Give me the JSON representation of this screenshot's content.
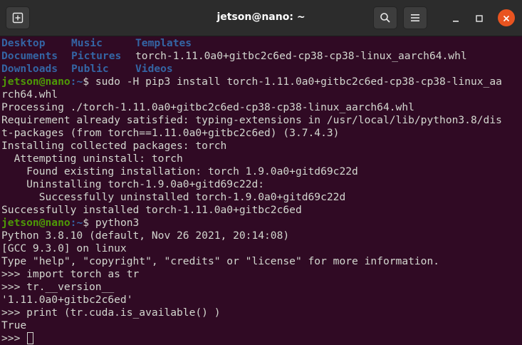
{
  "window": {
    "title": "jetson@nano: ~",
    "icons": {
      "new_tab": "new-tab-icon",
      "search": "search-icon",
      "menu": "hamburger-menu-icon",
      "minimize": "minimize-icon",
      "maximize": "maximize-icon",
      "close": "close-icon"
    },
    "colors": {
      "background": "#300a24",
      "titlebar": "#2c2c2c",
      "close": "#e95420",
      "dir": "#3465a4",
      "user": "#4e9a06",
      "text": "#d3d7cf"
    }
  },
  "ls_listing": [
    [
      "Desktop",
      "Music",
      "Templates"
    ],
    [
      "Documents",
      "Pictures",
      "torch-1.11.0a0+gitbc2c6ed-cp38-cp38-linux_aarch64.whl"
    ],
    [
      "Downloads",
      "Public",
      "Videos"
    ]
  ],
  "prompt": {
    "user": "jetson@nano",
    "path": ":~",
    "symbol": "$ "
  },
  "commands": {
    "pip_a": "sudo -H pip3 install torch-1.11.0a0+gitbc2c6ed-cp38-cp38-linux_aa",
    "pip_b": "rch64.whl",
    "python": "python3"
  },
  "output": {
    "l1": "Processing ./torch-1.11.0a0+gitbc2c6ed-cp38-cp38-linux_aarch64.whl",
    "l2": "Requirement already satisfied: typing-extensions in /usr/local/lib/python3.8/dis",
    "l3": "t-packages (from torch==1.11.0a0+gitbc2c6ed) (3.7.4.3)",
    "l4": "Installing collected packages: torch",
    "l5": "  Attempting uninstall: torch",
    "l6": "    Found existing installation: torch 1.9.0a0+gitd69c22d",
    "l7": "    Uninstalling torch-1.9.0a0+gitd69c22d:",
    "l8": "      Successfully uninstalled torch-1.9.0a0+gitd69c22d",
    "l9": "Successfully installed torch-1.11.0a0+gitbc2c6ed",
    "p1": "Python 3.8.10 (default, Nov 26 2021, 20:14:08)",
    "p2": "[GCC 9.3.0] on linux",
    "p3": "Type \"help\", \"copyright\", \"credits\" or \"license\" for more information.",
    "p4": ">>> import torch as tr",
    "p5": ">>> tr.__version__",
    "p6": "'1.11.0a0+gitbc2c6ed'",
    "p7": ">>> print (tr.cuda.is_available() )",
    "p8": "True",
    "p9": ">>> "
  }
}
